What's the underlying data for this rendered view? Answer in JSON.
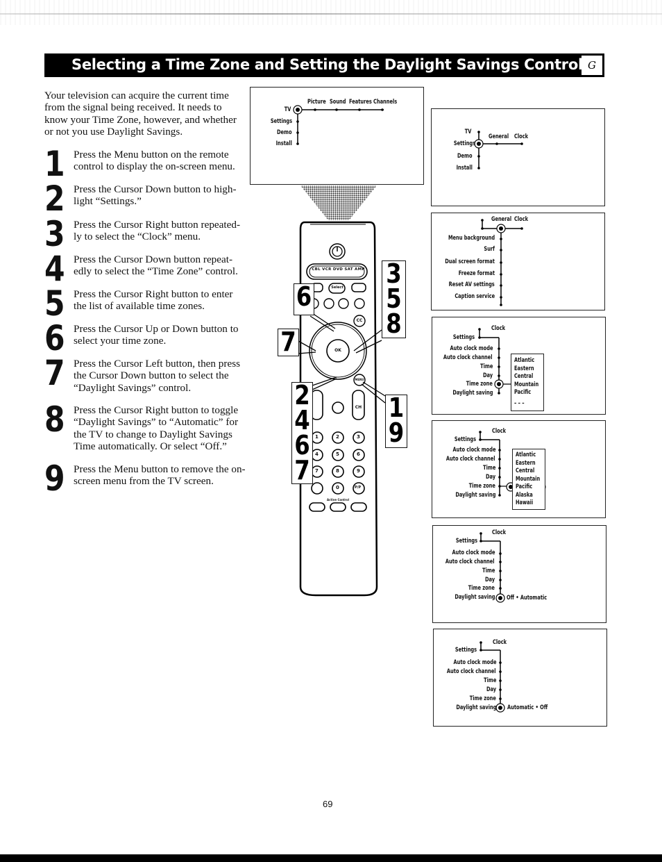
{
  "header": {
    "title": "Selecting a Time Zone and Setting the Daylight Savings Control",
    "section_tab": "G"
  },
  "intro": "Your television can acquire the current time from the signal being received. It needs to know your Time Zone, however, and whether or not you use Daylight Savings.",
  "steps": [
    {
      "num": "1",
      "text": "Press the Menu button on the remote control to display the on-screen menu."
    },
    {
      "num": "2",
      "text": "Press the Cursor Down button to high-light “Settings.”"
    },
    {
      "num": "3",
      "text": "Press the Cursor Right button repeated-ly to select the “Clock” menu."
    },
    {
      "num": "4",
      "text": "Press the Cursor Down button repeat-edly to select the “Time Zone” control."
    },
    {
      "num": "5",
      "text": "Press the Cursor Right button to enter the list of available time zones."
    },
    {
      "num": "6",
      "text": "Press the Cursor Up or Down button to select your time zone."
    },
    {
      "num": "7",
      "text": "Press the Cursor Left button, then press the Cursor Down button to select the “Daylight Savings” control."
    },
    {
      "num": "8",
      "text": "Press the Cursor Right button to toggle “Daylight Savings” to “Automatic” for the TV to change to Daylight Savings Time automatically. Or select “Off.”"
    },
    {
      "num": "9",
      "text": "Press the Menu button to remove the on-screen menu from the TV screen."
    }
  ],
  "menu_screens": {
    "main": {
      "root": "TV",
      "top": [
        "Picture",
        "Sound",
        "Features",
        "Channels"
      ],
      "side": [
        "Settings",
        "Demo",
        "Install"
      ]
    },
    "settings": {
      "side": [
        "TV",
        "Settings",
        "Demo",
        "Install"
      ],
      "top": [
        "General",
        "Clock"
      ]
    },
    "general": {
      "top": [
        "General",
        "Clock"
      ],
      "items": [
        "Menu background",
        "Surf",
        "Dual screen format",
        "Freeze format",
        "Reset AV settings",
        "Caption service"
      ]
    },
    "clock_zone": {
      "parent": "Settings",
      "title": "Clock",
      "items": [
        "Auto clock mode",
        "Auto clock channel",
        "Time",
        "Day",
        "Time zone",
        "Daylight saving"
      ],
      "zones": [
        "Atlantic",
        "Eastern",
        "Central",
        "Mountain",
        "Pacific",
        "– – –"
      ]
    },
    "clock_zone_list": {
      "parent": "Settings",
      "title": "Clock",
      "items": [
        "Auto clock mode",
        "Auto clock channel",
        "Time",
        "Day",
        "Time zone",
        "Daylight saving"
      ],
      "zones": [
        "Atlantic",
        "Eastern",
        "Central",
        "Mountain",
        "Pacific",
        "Alaska",
        "Hawaii"
      ],
      "selected_zone": "Pacific"
    },
    "daylight_off": {
      "parent": "Settings",
      "title": "Clock",
      "items": [
        "Auto clock mode",
        "Auto clock channel",
        "Time",
        "Day",
        "Time zone",
        "Daylight saving"
      ],
      "value": "Off • Automatic"
    },
    "daylight_auto": {
      "parent": "Settings",
      "title": "Clock",
      "items": [
        "Auto clock mode",
        "Auto clock channel",
        "Time",
        "Day",
        "Time zone",
        "Daylight saving"
      ],
      "value": "Automatic • Off"
    }
  },
  "remote": {
    "source_buttons": [
      "CBL",
      "VCR",
      "DVD",
      "SAT",
      "AMP"
    ],
    "select_label": "Select",
    "ok_label": "OK",
    "cc_label": "CC",
    "menu_label": "MENU",
    "ch_label": "CH",
    "keypad": [
      "1",
      "2",
      "3",
      "4",
      "5",
      "6",
      "7",
      "8",
      "9",
      "",
      "0",
      "P/P"
    ],
    "active_control_label": "Active Control",
    "callouts": {
      "left_upper": "6",
      "left_mid": "7",
      "left_lower": "2\n4\n6\n7",
      "right_upper": "3\n5\n8",
      "right_lower": "1\n9"
    }
  },
  "page_number": "69"
}
